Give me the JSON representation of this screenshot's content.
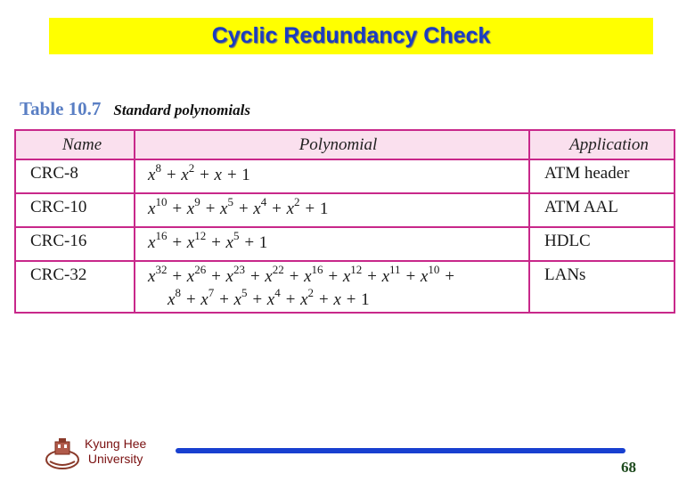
{
  "slide": {
    "title": "Cyclic Redundancy Check",
    "title_bg_color": "#ffff00",
    "title_text_color": "#1a3cc0",
    "page_number": "68"
  },
  "caption": {
    "number": "Table 10.7",
    "description": "Standard polynomials"
  },
  "table": {
    "border_color": "#c8288a",
    "header_bg_color": "#fae0ee",
    "headers": [
      "Name",
      "Polynomial",
      "Application"
    ],
    "rows": [
      {
        "name": "CRC-8",
        "polynomial_text": "x^8 + x^2 + x + 1",
        "application": "ATM header"
      },
      {
        "name": "CRC-10",
        "polynomial_text": "x^10 + x^9 + x^5 + x^4 + x^2 + 1",
        "application": "ATM AAL"
      },
      {
        "name": "CRC-16",
        "polynomial_text": "x^16 + x^12 + x^5 + 1",
        "application": "HDLC"
      },
      {
        "name": "CRC-32",
        "polynomial_text": "x^32 + x^26 + x^23 + x^22 + x^16 + x^12 + x^11 + x^10 + x^8 + x^7 + x^5 + x^4 + x^2 + x + 1",
        "application": "LANs"
      }
    ],
    "terms": {
      "r0": [
        [
          "x",
          "8"
        ],
        [
          "x",
          "2"
        ],
        [
          "x",
          ""
        ],
        [
          "1",
          ""
        ]
      ],
      "r1": [
        [
          "x",
          "10"
        ],
        [
          "x",
          "9"
        ],
        [
          "x",
          "5"
        ],
        [
          "x",
          "4"
        ],
        [
          "x",
          "2"
        ],
        [
          "1",
          ""
        ]
      ],
      "r2": [
        [
          "x",
          "16"
        ],
        [
          "x",
          "12"
        ],
        [
          "x",
          "5"
        ],
        [
          "1",
          ""
        ]
      ],
      "r3a": [
        [
          "x",
          "32"
        ],
        [
          "x",
          "26"
        ],
        [
          "x",
          "23"
        ],
        [
          "x",
          "22"
        ],
        [
          "x",
          "16"
        ],
        [
          "x",
          "12"
        ],
        [
          "x",
          "11"
        ],
        [
          "x",
          "10"
        ]
      ],
      "r3b": [
        [
          "x",
          "8"
        ],
        [
          "x",
          "7"
        ],
        [
          "x",
          "5"
        ],
        [
          "x",
          "4"
        ],
        [
          "x",
          "2"
        ],
        [
          "x",
          ""
        ],
        [
          "1",
          ""
        ]
      ]
    }
  },
  "footer": {
    "university_line1": "Kyung Hee",
    "university_line2": "University",
    "logo_icon": "university-emblem-icon"
  }
}
